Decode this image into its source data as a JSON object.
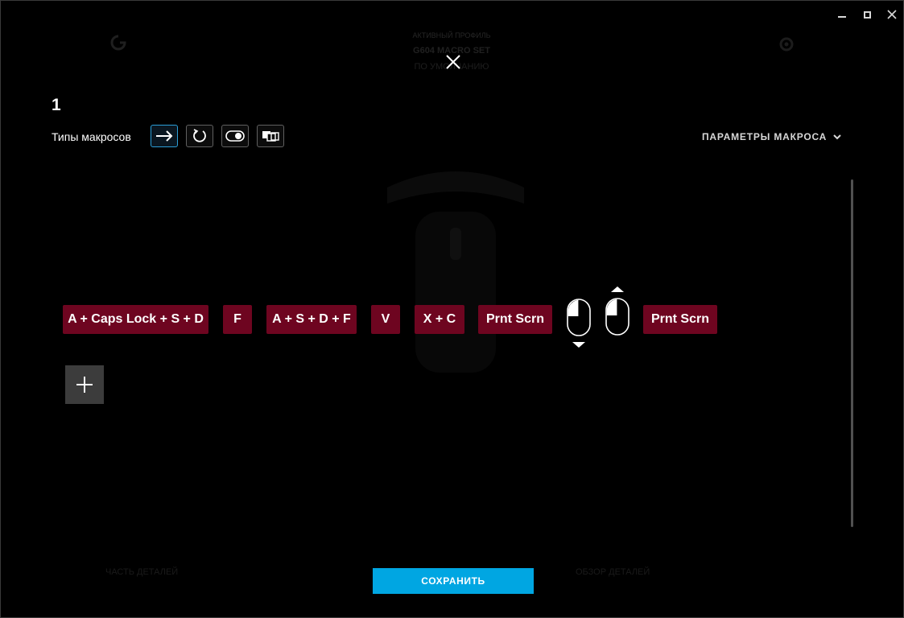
{
  "window": {
    "minimize_icon": "minimize-icon",
    "maximize_icon": "maximize-icon",
    "close_icon": "close-icon"
  },
  "background": {
    "profile_label": "АКТИВНЫЙ ПРОФИЛЬ",
    "profile_name": "G604 MACRO SET",
    "lock_status": "ПО УМОЛЧАНИЮ",
    "bottom_left": "ЧАСТЬ ДЕТАЛЕЙ",
    "bottom_right": "ОБЗОР ДЕТАЛЕЙ"
  },
  "editor": {
    "macro_name": "1",
    "types_label": "Типы макросов",
    "types": [
      {
        "icon": "arrow-right-icon",
        "active": true
      },
      {
        "icon": "repeat-icon",
        "active": false
      },
      {
        "icon": "toggle-icon",
        "active": false
      },
      {
        "icon": "sequence-icon",
        "active": false
      }
    ],
    "params_label": "ПАРАМЕТРЫ МАКРОСА",
    "params_icon": "chevron-down-icon",
    "steps": [
      {
        "kind": "key",
        "label": "A + Caps Lock + S + D"
      },
      {
        "kind": "key",
        "label": "F"
      },
      {
        "kind": "key",
        "label": "A + S + D + F"
      },
      {
        "kind": "key",
        "label": "V"
      },
      {
        "kind": "key",
        "label": "X + C"
      },
      {
        "kind": "key",
        "label": "Prnt Scrn"
      },
      {
        "kind": "mouse",
        "icon": "mouse-left-press-icon",
        "direction": "down"
      },
      {
        "kind": "mouse",
        "icon": "mouse-left-release-icon",
        "direction": "up"
      },
      {
        "kind": "key",
        "label": "Prnt Scrn"
      }
    ],
    "add_icon": "plus-icon",
    "save_label": "СОХРАНИТЬ"
  },
  "colors": {
    "background": "#000000",
    "key_chip": "#6e0520",
    "accent": "#00a6e2",
    "active_border": "#2c9fd8"
  }
}
